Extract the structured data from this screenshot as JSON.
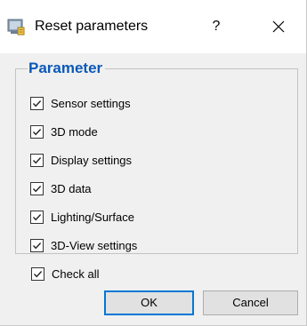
{
  "dialog": {
    "title": "Reset parameters",
    "help_label": "?",
    "icons": {
      "app": "settings-app-icon",
      "close": "close-icon"
    }
  },
  "group": {
    "legend": "Parameter",
    "items": [
      {
        "label": "Sensor settings",
        "checked": true
      },
      {
        "label": "3D mode",
        "checked": true
      },
      {
        "label": "Display settings",
        "checked": true
      },
      {
        "label": "3D data",
        "checked": true
      },
      {
        "label": "Lighting/Surface",
        "checked": true
      },
      {
        "label": "3D-View settings",
        "checked": true
      }
    ]
  },
  "check_all": {
    "label": "Check all",
    "checked": true
  },
  "buttons": {
    "ok_label": "OK",
    "cancel_label": "Cancel"
  },
  "colors": {
    "legend": "#0b59b8",
    "default_button_border": "#0078d7"
  }
}
